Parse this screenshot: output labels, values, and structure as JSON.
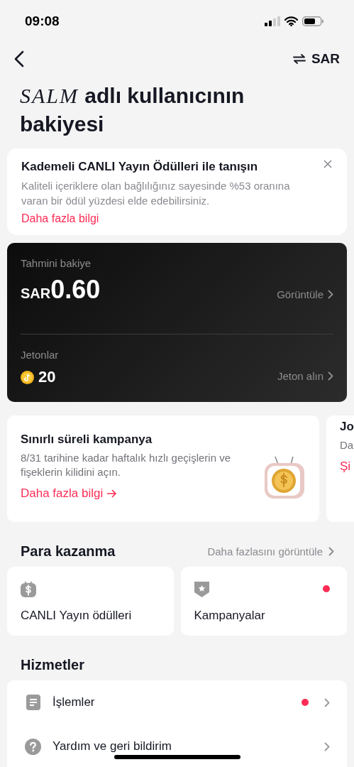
{
  "status_bar": {
    "time": "09:08"
  },
  "nav": {
    "currency": "SAR"
  },
  "heading": {
    "username": "SALM",
    "text": "adlı kullanıcının bakiyesi"
  },
  "info_banner": {
    "title": "Kademeli CANLI Yayın Ödülleri ile tanışın",
    "body": "Kaliteli içeriklere olan bağlılığınız sayesinde %53 oranına varan bir ödül yüzdesi elde edebilirsiniz.",
    "link": "Daha fazla bilgi"
  },
  "balance_card": {
    "label": "Tahmini bakiye",
    "currency": "SAR",
    "amount": "0.60",
    "view_link": "Görüntüle",
    "coins_label": "Jetonlar",
    "coins": "20",
    "buy_link": "Jeton alın"
  },
  "promos": [
    {
      "title": "Sınırlı süreli kampanya",
      "body": "8/31 tarihine kadar haftalık hızlı geçişlerin ve fişeklerin kilidini açın.",
      "link": "Daha fazla bilgi"
    },
    {
      "title": "Jo",
      "body": "Da",
      "link": "Şi"
    }
  ],
  "monetization": {
    "title": "Para kazanma",
    "more_link": "Daha fazlasını görüntüle",
    "tiles": [
      {
        "kind": "money",
        "label": "CANLI Yayın ödülleri",
        "badge": false
      },
      {
        "kind": "campaign",
        "label": "Kampanyalar",
        "badge": true
      }
    ]
  },
  "services": {
    "title": "Hizmetler",
    "items": [
      {
        "kind": "transactions",
        "label": "İşlemler",
        "badge": true
      },
      {
        "kind": "help",
        "label": "Yardım ve geri bildirim",
        "badge": false
      }
    ]
  }
}
